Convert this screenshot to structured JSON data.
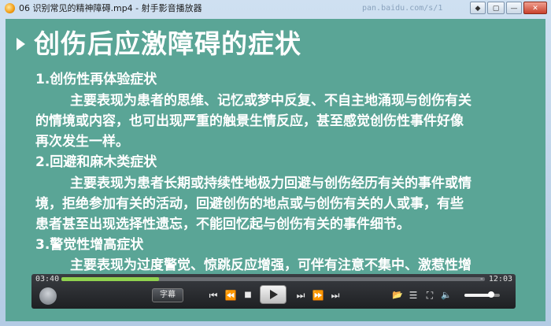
{
  "window": {
    "title": "06 识别常见的精神障碍.mp4 - 射手影音播放器",
    "watermark": "pan.baidu.com/s/1",
    "buttons": [
      "◆",
      "▢",
      "—",
      "✕"
    ]
  },
  "slide": {
    "title": "创伤后应激障碍的症状",
    "sections": [
      {
        "heading": "1.创伤性再体验症状",
        "lines": [
          "主要表现为患者的思维、记忆或梦中反复、不自主地涌现与创伤有关",
          "的情境或内容，也可出现严重的触景生情反应，甚至感觉创伤性事件好像",
          "再次发生一样。"
        ]
      },
      {
        "heading": "2.回避和麻木类症状",
        "lines": [
          "主要表现为患者长期或持续性地极力回避与创伤经历有关的事件或情",
          "境，拒绝参加有关的活动，回避创伤的地点或与创伤有关的人或事，有些",
          "患者甚至出现选择性遗忘，不能回忆起与创伤有关的事件细节。"
        ]
      },
      {
        "heading": "3.警觉性增高症状",
        "lines": [
          "主要表现为过度警觉、惊跳反应增强，可伴有注意不集中、激惹性增"
        ]
      }
    ]
  },
  "player": {
    "elapsed": "03:40",
    "remaining": "- 12:03",
    "progress": 0.23,
    "volume": 0.75,
    "subtitle_label": "字幕",
    "icons": {
      "prev_chapter": "⏮",
      "rewind": "⏪",
      "stop": "■",
      "play": "play",
      "next_frame": "⏭",
      "forward": "⏩",
      "next_chapter": "⏭",
      "open": "📂",
      "playlist": "☰",
      "fullscreen": "⛶",
      "volume": "🔈"
    }
  }
}
